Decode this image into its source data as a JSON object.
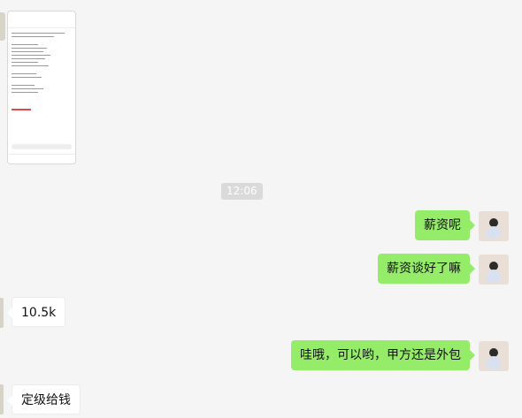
{
  "timestamp": "12:06",
  "thumbnail": {
    "label": "screenshot"
  },
  "messages": [
    {
      "side": "right",
      "text": "薪资呢"
    },
    {
      "side": "right",
      "text": "薪资谈好了嘛"
    },
    {
      "side": "left",
      "text": "10.5k"
    },
    {
      "side": "right",
      "text": "哇哦，可以哟，甲方还是外包"
    },
    {
      "side": "left",
      "text": "定级给钱"
    }
  ],
  "colors": {
    "background": "#f5f5f5",
    "outgoing_bubble": "#95ec69",
    "incoming_bubble": "#ffffff",
    "timestamp_bg": "#dadada"
  }
}
